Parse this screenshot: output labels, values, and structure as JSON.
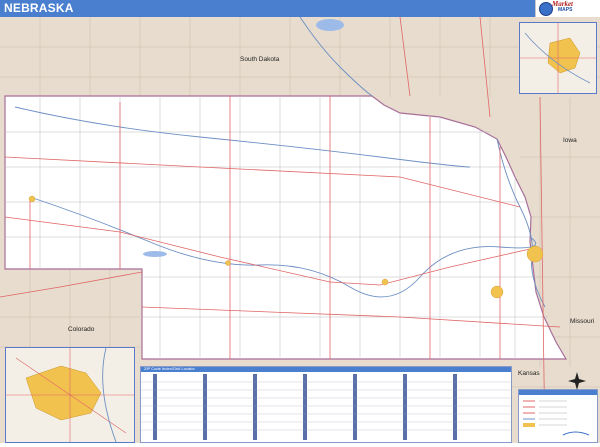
{
  "header": {
    "title": "NEBRASKA"
  },
  "logo": {
    "line1": "Market",
    "line2": "MAPS"
  },
  "labels": {
    "south_dakota": "South Dakota",
    "iowa": "Iowa",
    "colorado": "Colorado",
    "kansas": "Kansas",
    "missouri": "Missouri"
  },
  "zip_index": {
    "title": "ZIP Code Index/Grid Locator"
  },
  "legend": {
    "title": "2011 Nebraska Zip Code Map"
  },
  "colors": {
    "title_bar": "#4a7fd0",
    "land_ne": "#ffffff",
    "land_neighbor": "#e7dccd",
    "county_line": "#b9b9b9",
    "highway": "#e06565",
    "river": "#6d8fc4",
    "urban": "#f2c24f"
  },
  "icons": [
    "globe-icon",
    "compass-icon"
  ]
}
